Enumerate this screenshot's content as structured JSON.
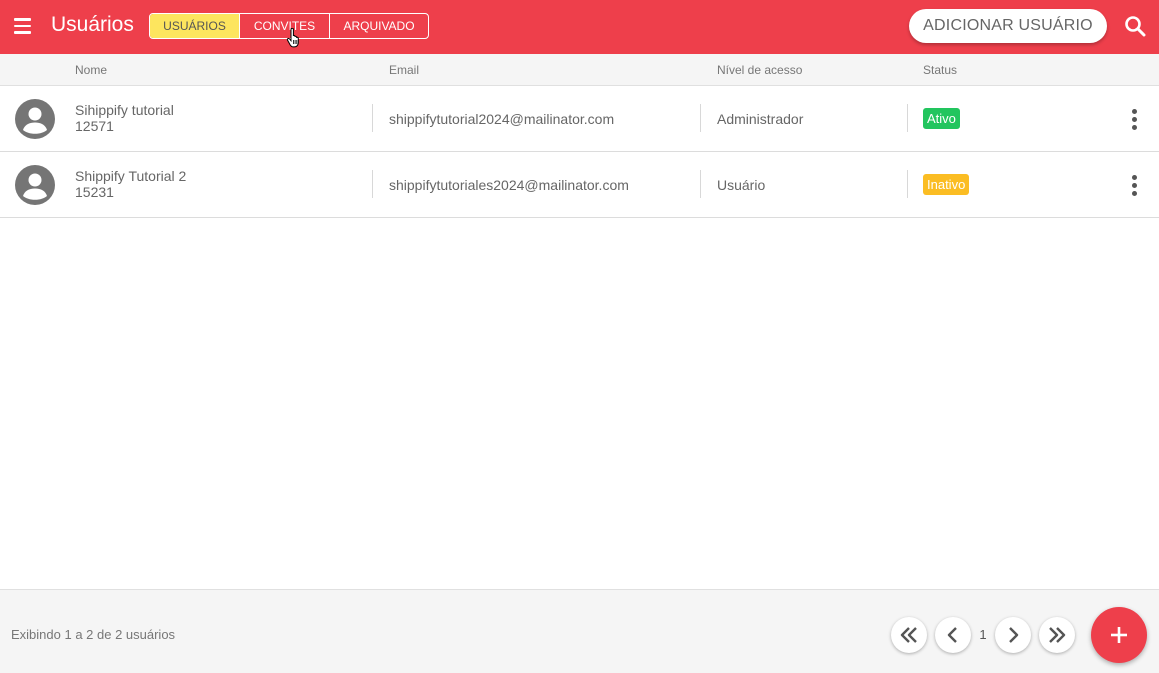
{
  "colors": {
    "primary": "#ee3f4b",
    "active_tab": "#fde55e",
    "status_active": "#22c55e",
    "status_inactive": "#fbbd23"
  },
  "header": {
    "menu_icon": "hamburger-icon",
    "title": "Usuários",
    "tabs": [
      {
        "label": "USUÁRIOS",
        "active": true
      },
      {
        "label": "CONVITES",
        "active": false
      },
      {
        "label": "ARQUIVADO",
        "active": false
      }
    ],
    "add_user_label": "ADICIONAR USUÁRIO",
    "search_icon": "search-icon"
  },
  "table": {
    "columns": {
      "name": "Nome",
      "email": "Email",
      "access": "Nível de acesso",
      "status": "Status"
    },
    "rows": [
      {
        "name": "Sihippify tutorial",
        "id": "12571",
        "email": "shippifytutorial2024@mailinator.com",
        "access": "Administrador",
        "status": "Ativo"
      },
      {
        "name": "Shippify Tutorial 2",
        "id": "15231",
        "email": "shippifytutoriales2024@mailinator.com",
        "access": "Usuário",
        "status": "Inativo"
      }
    ]
  },
  "footer": {
    "info": "Exibindo 1 a 2 de 2 usuários",
    "current_page": "1"
  }
}
